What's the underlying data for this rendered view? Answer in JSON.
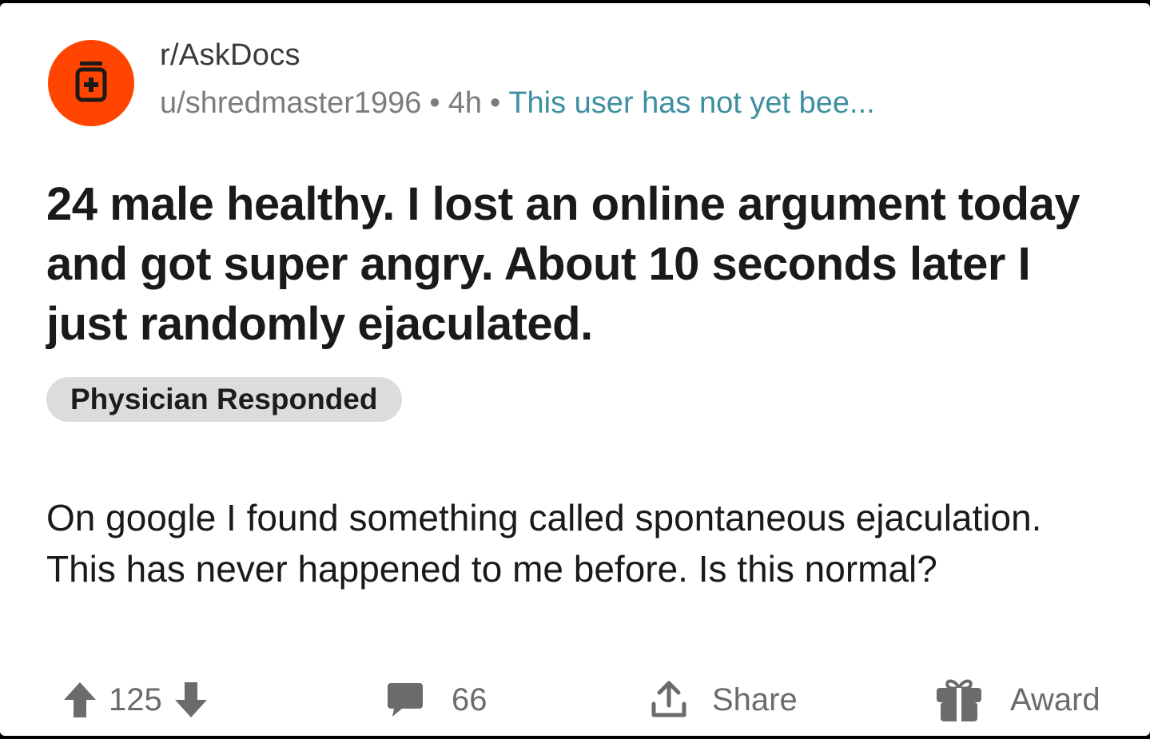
{
  "post": {
    "subreddit": "r/AskDocs",
    "author": "u/shredmaster1996",
    "separator": "•",
    "age": "4h",
    "user_flair": "This user has not yet bee...",
    "title": "24 male healthy. I lost an online argument today and got super angry. About 10 seconds later I just randomly ejaculated.",
    "post_flair": "Physician Responded",
    "body": "On google I found something called spontaneous ejaculation. This has never happened to me before. Is this normal?"
  },
  "actions": {
    "vote_count": "125",
    "comment_count": "66",
    "share_label": "Share",
    "award_label": "Award"
  },
  "colors": {
    "avatar_bg": "#ff4500",
    "flair_text": "#3d8f9f",
    "badge_bg": "#dcdcde"
  },
  "icons": {
    "avatar": "medical-bottle-icon",
    "upvote": "arrow-up-icon",
    "downvote": "arrow-down-icon",
    "comments": "comment-bubble-icon",
    "share": "share-upload-icon",
    "award": "gift-icon"
  }
}
